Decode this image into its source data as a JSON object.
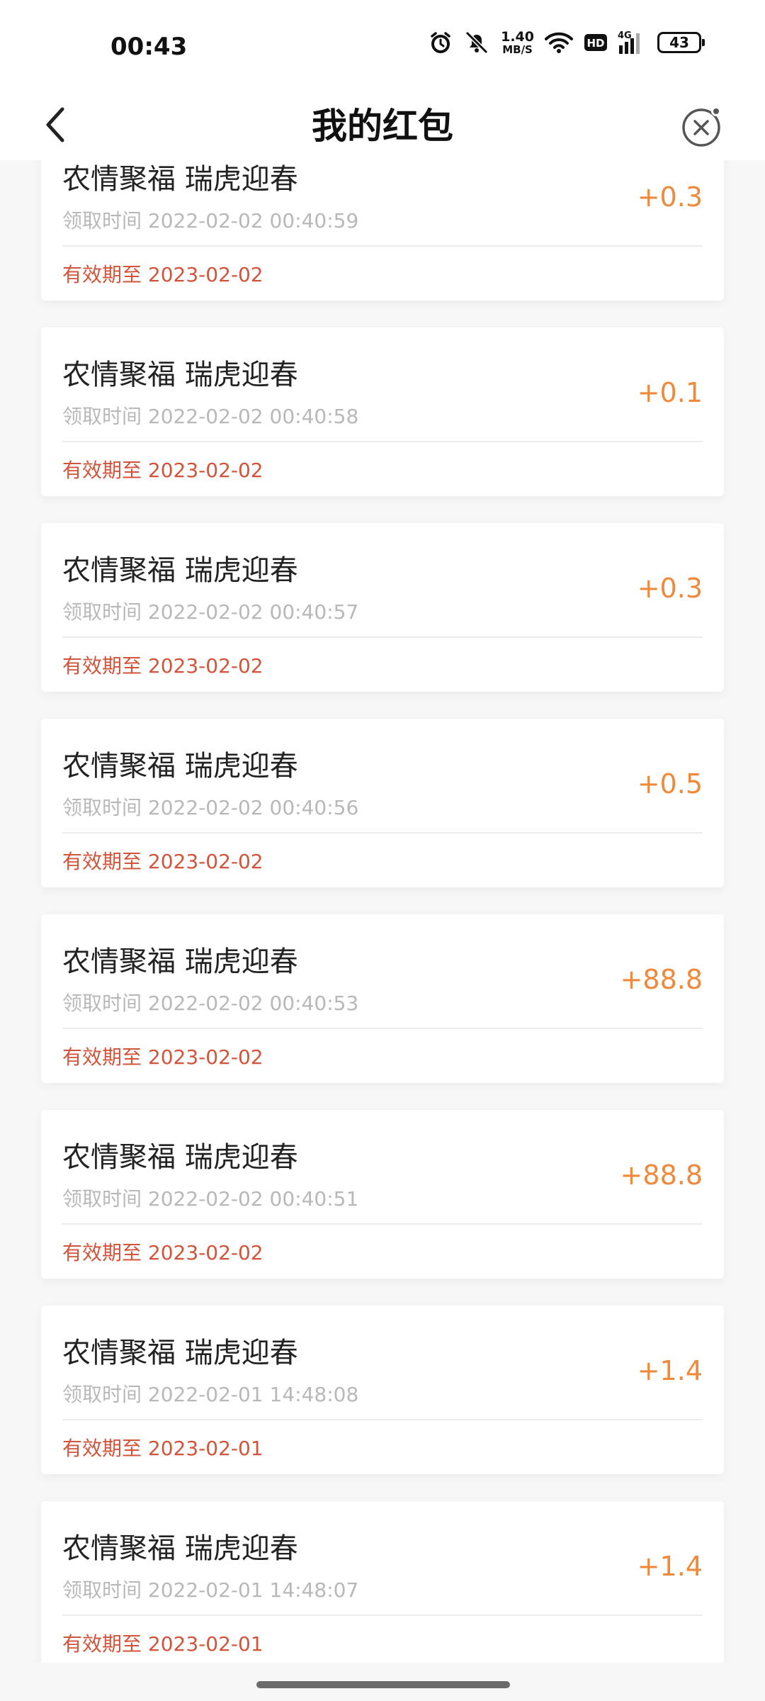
{
  "status_bar": {
    "time": "00:43",
    "net_speed_value": "1.40",
    "net_speed_unit": "MB/S",
    "hd_label": "HD",
    "signal_label": "4G",
    "battery": "43"
  },
  "header": {
    "title": "我的红包"
  },
  "list": {
    "items": [
      {
        "title": "农情聚福 瑞虎迎春",
        "time": "领取时间 2022-02-02 00:40:59",
        "expiry": "有效期至 2023-02-02",
        "amount": "+0.3"
      },
      {
        "title": "农情聚福 瑞虎迎春",
        "time": "领取时间 2022-02-02 00:40:58",
        "expiry": "有效期至 2023-02-02",
        "amount": "+0.1"
      },
      {
        "title": "农情聚福 瑞虎迎春",
        "time": "领取时间 2022-02-02 00:40:57",
        "expiry": "有效期至 2023-02-02",
        "amount": "+0.3"
      },
      {
        "title": "农情聚福 瑞虎迎春",
        "time": "领取时间 2022-02-02 00:40:56",
        "expiry": "有效期至 2023-02-02",
        "amount": "+0.5"
      },
      {
        "title": "农情聚福 瑞虎迎春",
        "time": "领取时间 2022-02-02 00:40:53",
        "expiry": "有效期至 2023-02-02",
        "amount": "+88.8"
      },
      {
        "title": "农情聚福 瑞虎迎春",
        "time": "领取时间 2022-02-02 00:40:51",
        "expiry": "有效期至 2023-02-02",
        "amount": "+88.8"
      },
      {
        "title": "农情聚福 瑞虎迎春",
        "time": "领取时间 2022-02-01 14:48:08",
        "expiry": "有效期至 2023-02-01",
        "amount": "+1.4"
      },
      {
        "title": "农情聚福 瑞虎迎春",
        "time": "领取时间 2022-02-01 14:48:07",
        "expiry": "有效期至 2023-02-01",
        "amount": "+1.4"
      }
    ]
  },
  "colors": {
    "amount": "#ef8a3d",
    "expiry": "#d2543a",
    "timestamp": "#b8b8b8",
    "background": "#f7f7f7"
  },
  "icons": {
    "back": "chevron-left-icon",
    "close": "close-circle-icon",
    "alarm": "alarm-icon",
    "mute": "bell-off-icon",
    "wifi": "wifi-icon",
    "signal": "signal-icon",
    "battery": "battery-icon"
  }
}
